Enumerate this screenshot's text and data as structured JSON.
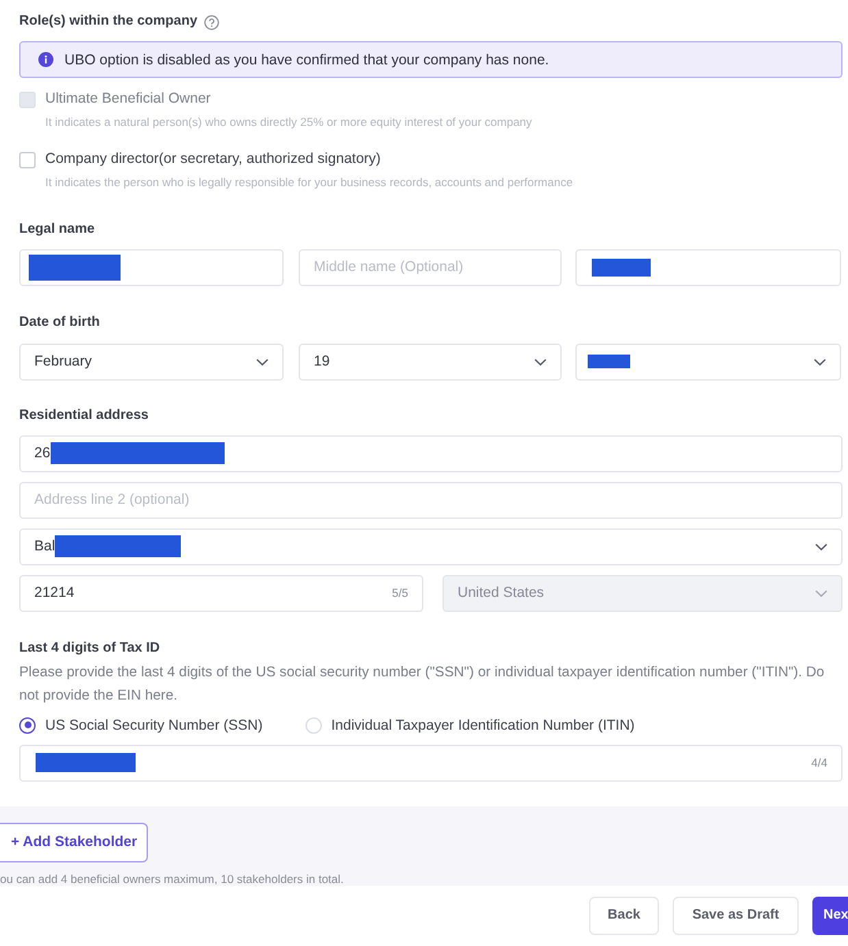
{
  "roles": {
    "title": "Role(s) within the company",
    "notice": "UBO option is disabled as you have confirmed that your company has none.",
    "options": [
      {
        "label": "Ultimate Beneficial Owner",
        "description": "It indicates a natural person(s) who owns directly 25% or more equity interest of your company",
        "checked": false,
        "disabled": true
      },
      {
        "label": "Company director(or secretary, authorized signatory)",
        "description": "It indicates the person who is legally responsible for your business records, accounts and performance",
        "checked": false,
        "disabled": false
      }
    ]
  },
  "legal_name": {
    "label": "Legal name",
    "fields": [
      {
        "kind": "input",
        "redacted": true
      },
      {
        "kind": "input",
        "placeholder": "Middle name (Optional)",
        "redacted": false
      },
      {
        "kind": "input",
        "redacted": true
      }
    ]
  },
  "date_of_birth": {
    "label": "Date of birth",
    "fields": [
      {
        "kind": "select",
        "value": "February",
        "redacted": false
      },
      {
        "kind": "select",
        "value": "19",
        "redacted": false
      },
      {
        "kind": "select",
        "redacted": true
      }
    ]
  },
  "residential_address": {
    "label": "Residential address",
    "fields": [
      {
        "kind": "input",
        "value": "26",
        "redacted": true,
        "disabled": false
      },
      {
        "kind": "input",
        "placeholder": "Address line 2 (optional)",
        "redacted": false,
        "disabled": false
      },
      {
        "kind": "select",
        "value": "Bal",
        "redacted": true,
        "disabled": false
      },
      {
        "kind": "input",
        "value": "21214",
        "counter": "5/5",
        "redacted": false,
        "disabled": false
      },
      {
        "kind": "select",
        "value": "United States",
        "redacted": false,
        "disabled": true
      }
    ]
  },
  "tax_id": {
    "label": "Last 4 digits of Tax ID",
    "help": "Please provide the last 4 digits of the US social security number (\"SSN\") or individual taxpayer identification number (\"ITIN\"). Do not provide the EIN here.",
    "id_types": [
      {
        "label": "US Social Security Number (SSN)",
        "selected": true
      },
      {
        "label": "Individual Taxpayer Identification Number (ITIN)",
        "selected": false
      }
    ],
    "fields": [
      {
        "kind": "input",
        "redacted": true,
        "counter": "4/4"
      }
    ]
  },
  "footer": {
    "add_button": "+ Add Stakeholder",
    "note": "ou can add 4 beneficial owners maximum, 10 stakeholders in total.",
    "buttons": [
      {
        "label": "Back",
        "kind": "secondary"
      },
      {
        "label": "Save as Draft",
        "kind": "secondary"
      },
      {
        "label": "Nex",
        "kind": "primary"
      }
    ]
  }
}
